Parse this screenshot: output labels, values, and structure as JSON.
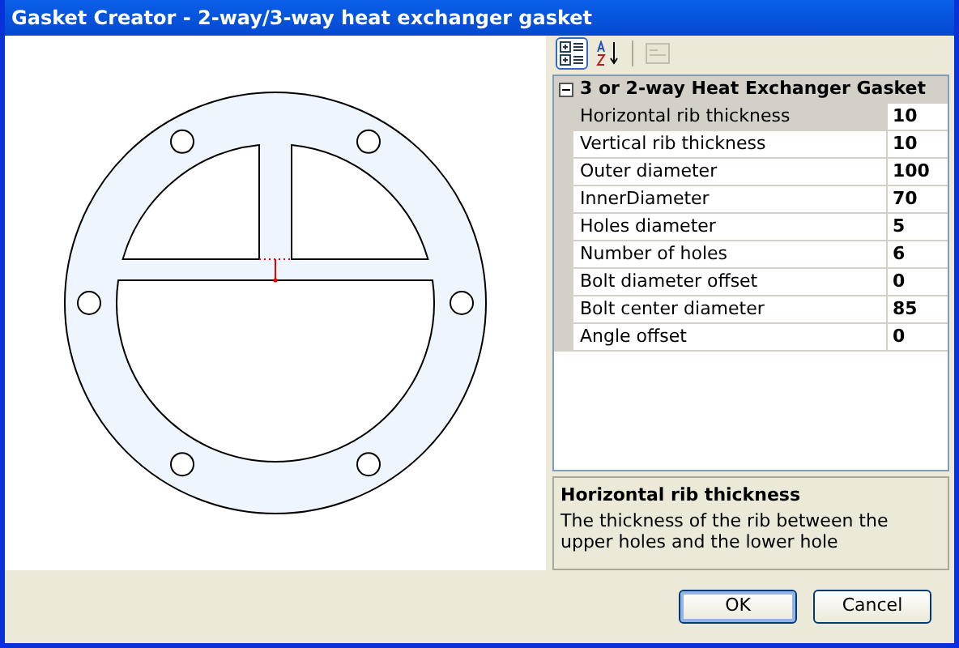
{
  "window": {
    "title": "Gasket Creator - 2-way/3-way heat exchanger gasket"
  },
  "toolbar": [
    {
      "kind": "categorized",
      "selected": true,
      "disabled": false
    },
    {
      "kind": "alphabetical",
      "selected": false,
      "disabled": false
    },
    {
      "kind": "pages",
      "selected": false,
      "disabled": true
    }
  ],
  "category": {
    "label": "3 or 2-way Heat Exchanger Gasket",
    "expanded": true
  },
  "properties": [
    {
      "name": "Horizontal rib thickness",
      "value": "10",
      "selected": true
    },
    {
      "name": "Vertical rib thickness",
      "value": "10",
      "selected": false
    },
    {
      "name": "Outer diameter",
      "value": "100",
      "selected": false
    },
    {
      "name": "InnerDiameter",
      "value": "70",
      "selected": false
    },
    {
      "name": "Holes diameter",
      "value": "5",
      "selected": false
    },
    {
      "name": "Number of holes",
      "value": "6",
      "selected": false
    },
    {
      "name": "Bolt diameter offset",
      "value": "0",
      "selected": false
    },
    {
      "name": "Bolt center diameter",
      "value": "85",
      "selected": false
    },
    {
      "name": "Angle offset",
      "value": "0",
      "selected": false
    }
  ],
  "description": {
    "title": "Horizontal rib thickness",
    "text": "The thickness of the rib between the upper holes and the lower hole"
  },
  "buttons": [
    {
      "label": "OK",
      "default": true
    },
    {
      "label": "Cancel",
      "default": false
    }
  ]
}
